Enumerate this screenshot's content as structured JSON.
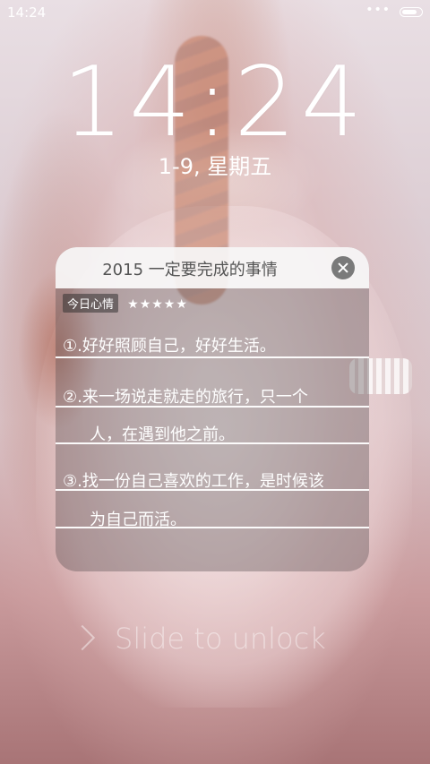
{
  "status_bar": {
    "time": "14:24",
    "dots": "•••",
    "battery_level": 0.85
  },
  "lockscreen": {
    "clock": "14:24",
    "date": "1-9, 星期五",
    "unlock_hint": "Slide to unlock"
  },
  "widget": {
    "title": "2015 一定要完成的事情",
    "mood_label": "今日心情",
    "mood_stars": "★★★★★",
    "mood_rating": 5,
    "notes": [
      {
        "line": "①.好好照顾自己，好好生活。"
      },
      {
        "line": "②.来一场说走就走的旅行，只一个"
      },
      {
        "line": "人，在遇到他之前。"
      },
      {
        "line": "③.找一份自己喜欢的工作，是时候该"
      },
      {
        "line": "为自己而活。"
      }
    ]
  }
}
